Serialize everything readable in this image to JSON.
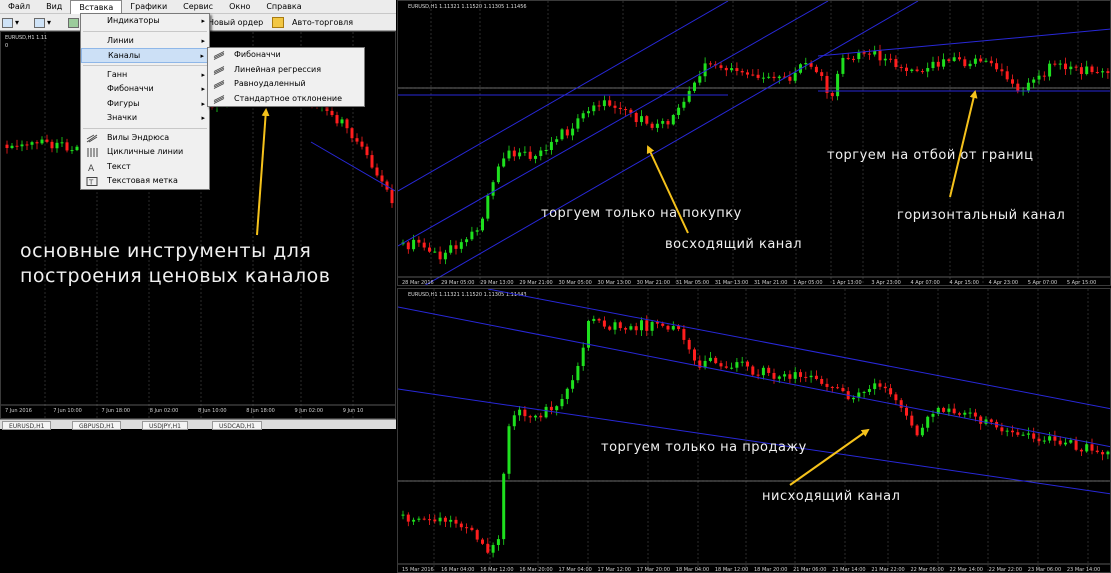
{
  "menubar": {
    "items": [
      "Файл",
      "Вид",
      "Вставка",
      "Графики",
      "Сервис",
      "Окно",
      "Справка"
    ],
    "active": "Вставка"
  },
  "toolbar": {
    "new_order": "Новый ордер",
    "auto_trading": "Авто-торговля"
  },
  "insert_menu": {
    "items": [
      {
        "label": "Индикаторы",
        "submenu": true,
        "icon": "none"
      },
      {
        "label": "Линии",
        "submenu": true,
        "icon": "none"
      },
      {
        "label": "Каналы",
        "submenu": true,
        "icon": "none",
        "highlighted": true
      },
      {
        "label": "Ганн",
        "submenu": true,
        "icon": "none"
      },
      {
        "label": "Фибоначчи",
        "submenu": true,
        "icon": "none"
      },
      {
        "label": "Фигуры",
        "submenu": true,
        "icon": "none"
      },
      {
        "label": "Значки",
        "submenu": true,
        "icon": "none"
      },
      {
        "label": "Вилы Эндрюса",
        "submenu": false,
        "icon": "andrews-pitchfork-icon"
      },
      {
        "label": "Цикличные линии",
        "submenu": false,
        "icon": "cycle-lines-icon"
      },
      {
        "label": "Текст",
        "submenu": false,
        "icon": "text-icon"
      },
      {
        "label": "Текстовая метка",
        "submenu": false,
        "icon": "text-label-icon"
      }
    ]
  },
  "channels_submenu": {
    "items": [
      {
        "label": "Фибоначчи",
        "icon": "fibo-channel-icon"
      },
      {
        "label": "Линейная регрессия",
        "icon": "regression-channel-icon"
      },
      {
        "label": "Равноудаленный",
        "icon": "equidistant-channel-icon"
      },
      {
        "label": "Стандартное отклонение",
        "icon": "stddev-channel-icon"
      }
    ]
  },
  "left_chart": {
    "title": "EURUSD,H1  1.11",
    "title_sub": "0",
    "x_labels": [
      "7 Jun 2016",
      "7 Jun 10:00",
      "7 Jun 18:00",
      "8 Jun 02:00",
      "8 Jun 10:00",
      "8 Jun 18:00",
      "9 Jun 02:00",
      "9 Jun 10"
    ],
    "tabs": [
      "EURUSD,H1",
      "GBPUSD,H1",
      "USDJPY,H1",
      "USDCAD,H1"
    ]
  },
  "top_chart": {
    "title": "EURUSD,H1  1.11321 1.11520 1.11305 1.11456",
    "x_labels": [
      "28 Mar 2016",
      "29 Mar 05:00",
      "29 Mar 13:00",
      "29 Mar 21:00",
      "30 Mar 05:00",
      "30 Mar 13:00",
      "30 Mar 21:00",
      "31 Mar 05:00",
      "31 Mar 13:00",
      "31 Mar 21:00",
      "1 Apr 05:00",
      "1 Apr 13:00",
      "3 Apr 23:00",
      "4 Apr 07:00",
      "4 Apr 15:00",
      "4 Apr 23:00",
      "5 Apr 07:00",
      "5 Apr 15:00"
    ]
  },
  "bottom_chart": {
    "title": "EURUSD,H1  1.11321 1.11520 1.11305 1.11443",
    "x_labels": [
      "15 Mar 2016",
      "16 Mar 04:00",
      "16 Mar 12:00",
      "16 Mar 20:00",
      "17 Mar 04:00",
      "17 Mar 12:00",
      "17 Mar 20:00",
      "18 Mar 04:00",
      "18 Mar 12:00",
      "18 Mar 20:00",
      "21 Mar 06:00",
      "21 Mar 14:00",
      "21 Mar 22:00",
      "22 Mar 06:00",
      "22 Mar 14:00",
      "22 Mar 22:00",
      "23 Mar 06:00",
      "23 Mar 14:00"
    ]
  },
  "annotations": {
    "main_tools_line1": "основные инструменты для",
    "main_tools_line2": "построения ценовых каналов",
    "buy_only": "торгуем только на покупку",
    "ascending": "восходящий канал",
    "bounce": "торгуем на отбой от границ",
    "horizontal": "горизонтальный канал",
    "sell_only": "торгуем только на продажу",
    "descending": "нисходящий канал"
  },
  "colors": {
    "bull": "#1ee01e",
    "bear": "#ff1e1e",
    "channel": "#2828d8",
    "arrow": "#f5c21b",
    "grid": "#4a4a4a"
  }
}
